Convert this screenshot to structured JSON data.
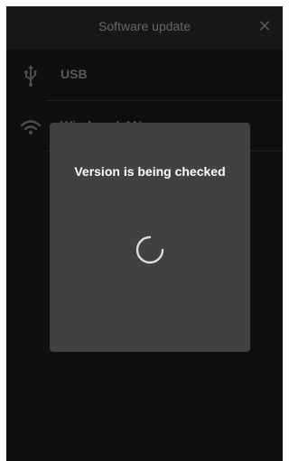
{
  "header": {
    "title": "Software update",
    "close_icon": "close-icon"
  },
  "options": [
    {
      "label": "USB",
      "icon": "usb-icon"
    },
    {
      "label": "Wireless LAN",
      "icon": "wifi-icon"
    }
  ],
  "dialog": {
    "message": "Version is being checked",
    "spinner_icon": "loading-spinner-icon"
  },
  "colors": {
    "background": "#141414",
    "header": "#1f1f1f",
    "dialog": "#3f4142",
    "text_muted": "#777777",
    "text_primary": "#ffffff"
  }
}
